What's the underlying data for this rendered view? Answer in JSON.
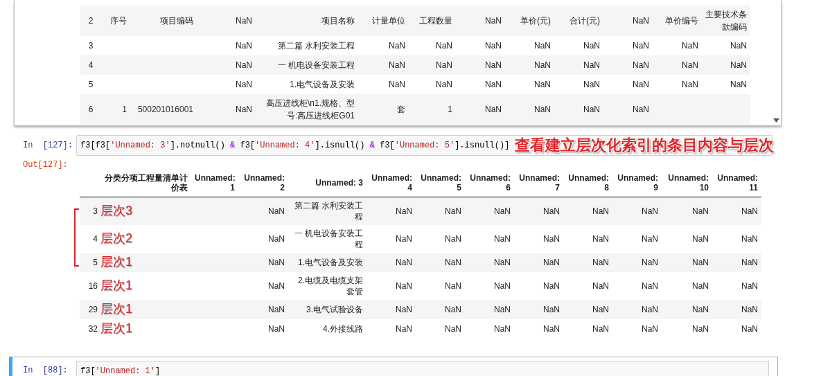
{
  "top_output": {
    "rows": [
      {
        "cells": [
          "2",
          "序号",
          "项目编码",
          "NaN",
          "项目名称",
          "计量单位",
          "工程数量",
          "NaN",
          "单价(元)",
          "合计(元)",
          "NaN",
          "单价编号",
          "主要技术条款编码"
        ]
      },
      {
        "cells": [
          "3",
          "",
          "",
          "NaN",
          "第二篇 水利安装工程",
          "NaN",
          "NaN",
          "NaN",
          "NaN",
          "NaN",
          "NaN",
          "NaN",
          "NaN"
        ]
      },
      {
        "cells": [
          "4",
          "",
          "",
          "NaN",
          "一 机电设备安装工程",
          "NaN",
          "NaN",
          "NaN",
          "NaN",
          "NaN",
          "NaN",
          "NaN",
          "NaN"
        ]
      },
      {
        "cells": [
          "5",
          "",
          "",
          "NaN",
          "1.电气设备及安装",
          "NaN",
          "NaN",
          "NaN",
          "NaN",
          "NaN",
          "NaN",
          "NaN",
          "NaN"
        ]
      },
      {
        "cells": [
          "6",
          "1",
          "500201016001",
          "NaN",
          "高压进线柜\\n1.规格、型号:高压进线柜G01",
          "套",
          "1",
          "NaN",
          "NaN",
          "NaN",
          "NaN",
          "",
          ""
        ]
      }
    ]
  },
  "cell_127": {
    "prompt": "In  [127]:",
    "code": [
      {
        "kind": "plain",
        "text": "f3[f3["
      },
      {
        "kind": "string",
        "text": "'Unnamed: 3'"
      },
      {
        "kind": "plain",
        "text": "].notnull() "
      },
      {
        "kind": "operator",
        "text": "&"
      },
      {
        "kind": "plain",
        "text": " f3["
      },
      {
        "kind": "string",
        "text": "'Unnamed: 4'"
      },
      {
        "kind": "plain",
        "text": "].isnull() "
      },
      {
        "kind": "operator",
        "text": "&"
      },
      {
        "kind": "plain",
        "text": " f3["
      },
      {
        "kind": "string",
        "text": "'Unnamed: 5'"
      },
      {
        "kind": "plain",
        "text": "].isnull()]"
      }
    ],
    "annotation": "查看建立层次化索引的条目内容与层次"
  },
  "out_127": {
    "prompt": "Out[127]:",
    "columns": [
      "",
      "分类分项工程量清单计价表",
      "Unnamed: 1",
      "Unnamed: 2",
      "Unnamed: 3",
      "Unnamed: 4",
      "Unnamed: 5",
      "Unnamed: 6",
      "Unnamed: 7",
      "Unnamed: 8",
      "Unnamed: 9",
      "Unnamed: 10",
      "Unnamed: 11"
    ],
    "rows": [
      {
        "annotation": "层次3",
        "cells": [
          "3",
          "",
          "",
          "NaN",
          "第二篇 水利安装工程",
          "NaN",
          "NaN",
          "NaN",
          "NaN",
          "NaN",
          "NaN",
          "NaN",
          "NaN"
        ]
      },
      {
        "annotation": "层次2",
        "cells": [
          "4",
          "",
          "",
          "NaN",
          "一 机电设备安装工程",
          "NaN",
          "NaN",
          "NaN",
          "NaN",
          "NaN",
          "NaN",
          "NaN",
          "NaN"
        ]
      },
      {
        "annotation": "层次1",
        "cells": [
          "5",
          "",
          "",
          "NaN",
          "1.电气设备及安装",
          "NaN",
          "NaN",
          "NaN",
          "NaN",
          "NaN",
          "NaN",
          "NaN",
          "NaN"
        ]
      },
      {
        "annotation": "层次1",
        "cells": [
          "16",
          "",
          "",
          "NaN",
          "2.电缆及电缆支架套管",
          "NaN",
          "NaN",
          "NaN",
          "NaN",
          "NaN",
          "NaN",
          "NaN",
          "NaN"
        ]
      },
      {
        "annotation": "层次1",
        "cells": [
          "29",
          "",
          "",
          "NaN",
          "3.电气试验设备",
          "NaN",
          "NaN",
          "NaN",
          "NaN",
          "NaN",
          "NaN",
          "NaN",
          "NaN"
        ]
      },
      {
        "annotation": "层次1",
        "cells": [
          "32",
          "",
          "",
          "NaN",
          "4.外接线路",
          "NaN",
          "NaN",
          "NaN",
          "NaN",
          "NaN",
          "NaN",
          "NaN",
          "NaN"
        ]
      }
    ]
  },
  "cell_88": {
    "prompt": "In  [88]:",
    "selected": true,
    "code": [
      {
        "kind": "plain",
        "text": "f3["
      },
      {
        "kind": "string",
        "text": "'Unnamed: 1'"
      },
      {
        "kind": "plain",
        "text": "]"
      }
    ]
  }
}
